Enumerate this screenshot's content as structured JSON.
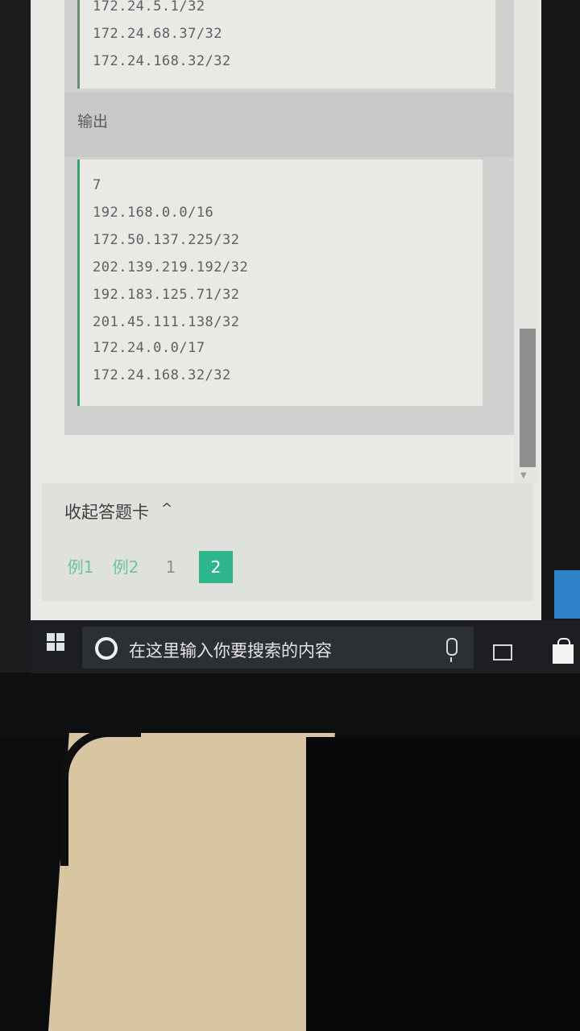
{
  "input_block": {
    "lines": [
      "172.24.5.1/32",
      "172.24.68.37/32",
      "172.24.168.32/32"
    ]
  },
  "output_label": "输出",
  "output_block": {
    "lines": [
      "7",
      "192.168.0.0/16",
      "172.50.137.225/32",
      "202.139.219.192/32",
      "192.183.125.71/32",
      "201.45.111.138/32",
      "172.24.0.0/17",
      "172.24.168.32/32"
    ]
  },
  "answer_card": {
    "collapse_label": "收起答题卡",
    "pages": [
      "例1",
      "例2",
      "1",
      "2"
    ],
    "active_page": "2"
  },
  "taskbar": {
    "search_placeholder": "在这里输入你要搜索的内容",
    "icons": [
      "windows-start-icon",
      "cortana-icon",
      "microphone-icon",
      "task-view-icon",
      "store-icon"
    ]
  },
  "colors": {
    "accent_green": "#2fb58b",
    "code_border": "#3aa46f",
    "taskbar": "#1c1e21"
  }
}
